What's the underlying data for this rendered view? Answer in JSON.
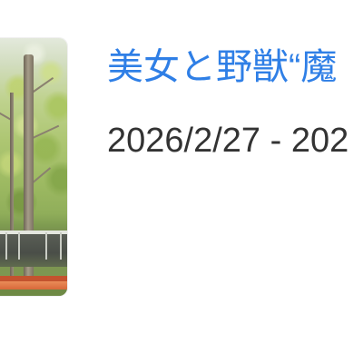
{
  "list_item": {
    "thumbnail": "photo-thumbnail",
    "title": "美女と野獣“魔",
    "date_range": "2026/2/27 - 202"
  },
  "colors": {
    "title": "#2f7fe6",
    "date": "#333333",
    "background": "#ffffff"
  }
}
